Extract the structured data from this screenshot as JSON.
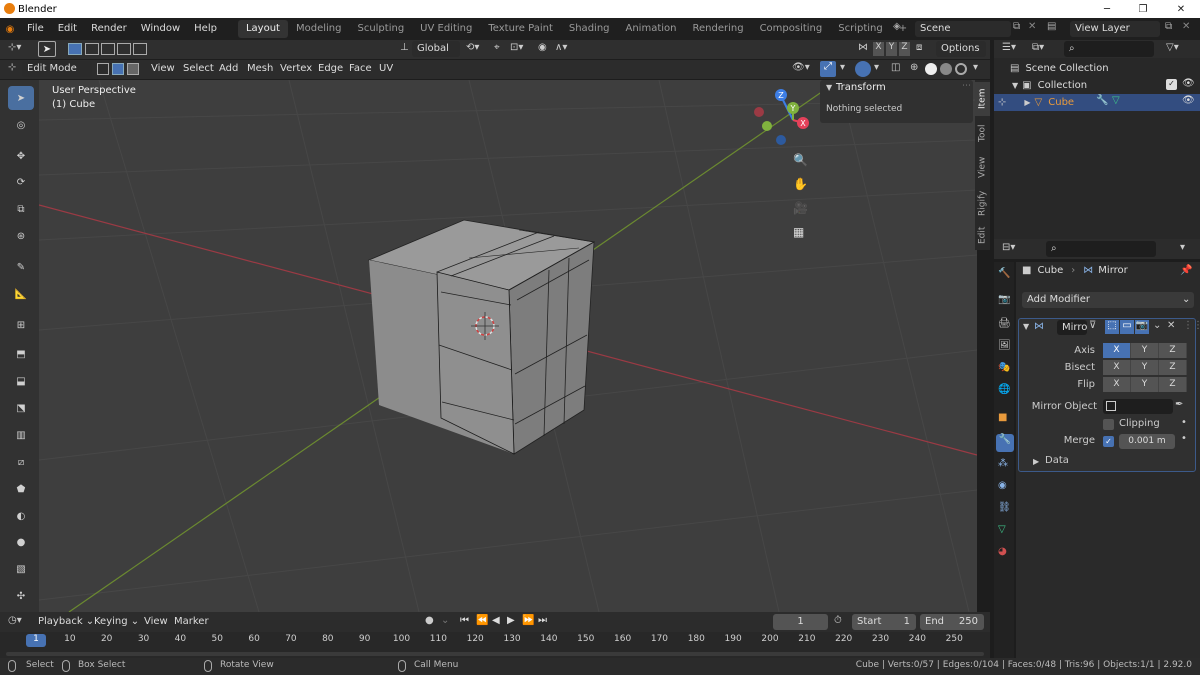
{
  "window": {
    "app_title": "Blender",
    "minimize_glyph": "─",
    "maximize_glyph": "❐",
    "close_glyph": "✕"
  },
  "menus": [
    "File",
    "Edit",
    "Render",
    "Window",
    "Help"
  ],
  "workspaces": [
    "Layout",
    "Modeling",
    "Sculpting",
    "UV Editing",
    "Texture Paint",
    "Shading",
    "Animation",
    "Rendering",
    "Compositing",
    "Scripting"
  ],
  "workspace_add": "+",
  "scene": {
    "name": "Scene",
    "view_layer": "View Layer"
  },
  "toolbar_row": {
    "orientation": "Global",
    "options": "Options",
    "axes": [
      "X",
      "Y",
      "Z"
    ]
  },
  "viewport_header": {
    "mode": "Edit Mode",
    "menus": [
      "View",
      "Select",
      "Add",
      "Mesh",
      "Vertex",
      "Edge",
      "Face",
      "UV"
    ]
  },
  "viewport": {
    "perspective": "User Perspective",
    "object": "(1) Cube"
  },
  "gizmo": {
    "x": "X",
    "y": "Y",
    "z": "Z"
  },
  "npanel": {
    "header": "Transform",
    "message": "Nothing selected"
  },
  "sidebar_tabs": [
    "Item",
    "Tool",
    "View",
    "Rigify",
    "Edit"
  ],
  "outliner": {
    "root": "Scene Collection",
    "collection": "Collection",
    "object": "Cube"
  },
  "properties": {
    "breadcrumb_object": "Cube",
    "breadcrumb_modifier": "Mirror",
    "add_modifier": "Add Modifier",
    "modifier_name": "Mirro",
    "axis_label": "Axis",
    "bisect_label": "Bisect",
    "flip_label": "Flip",
    "axes": [
      "X",
      "Y",
      "Z"
    ],
    "mirror_object_label": "Mirror Object",
    "clipping_label": "Clipping",
    "merge_label": "Merge",
    "merge_value": "0.001 m",
    "data_label": "Data"
  },
  "timeline": {
    "menus": [
      "Playback",
      "Keying",
      "View",
      "Marker"
    ],
    "current_frame": "1",
    "start_label": "Start",
    "start_value": "1",
    "end_label": "End",
    "end_value": "250",
    "ticks": [
      "1",
      "10",
      "20",
      "30",
      "40",
      "50",
      "60",
      "70",
      "80",
      "90",
      "100",
      "110",
      "120",
      "130",
      "140",
      "150",
      "160",
      "170",
      "180",
      "190",
      "200",
      "210",
      "220",
      "230",
      "240",
      "250"
    ]
  },
  "status": {
    "select": "Select",
    "box_select": "Box Select",
    "rotate": "Rotate View",
    "call_menu": "Call Menu",
    "stats": "Cube | Verts:0/57 | Edges:0/104 | Faces:0/48 | Tris:96 | Objects:1/1 | 2.92.0"
  },
  "colors": {
    "accent": "#4772b3",
    "x_axis": "#e4415a",
    "y_axis": "#80b23e",
    "z_axis": "#3d7ee5",
    "object_orange": "#e89a3c"
  }
}
